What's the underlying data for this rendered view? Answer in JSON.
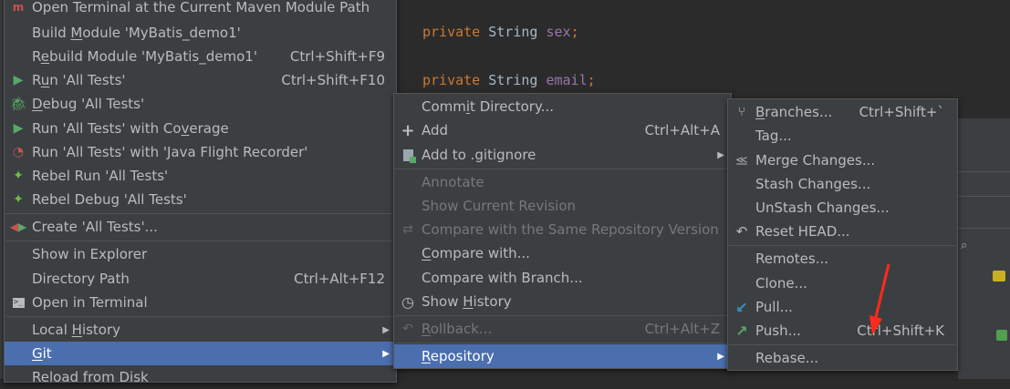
{
  "editor": {
    "line1": {
      "kw": "private",
      "type": "String",
      "field": "sex",
      "punct": ";"
    },
    "line2": {
      "kw": "private",
      "type": "String",
      "field": "email",
      "punct": ";"
    }
  },
  "context_menu": {
    "items": [
      {
        "label": "Open Terminal at the Current Maven Module Path",
        "icon": "maven-icon"
      },
      {
        "label": "Build Module 'MyBatis_demo1'",
        "shortcut": ""
      },
      {
        "label": "Rebuild Module 'MyBatis_demo1'",
        "shortcut": "Ctrl+Shift+F9"
      },
      {
        "label": "Run 'All Tests'",
        "shortcut": "Ctrl+Shift+F10",
        "icon": "run-icon"
      },
      {
        "label": "Debug 'All Tests'",
        "icon": "debug-icon"
      },
      {
        "label": "Run 'All Tests' with Coverage",
        "icon": "coverage-icon"
      },
      {
        "label": "Run 'All Tests' with 'Java Flight Recorder'",
        "icon": "flight-recorder-icon"
      },
      {
        "label": "Rebel Run 'All Tests'",
        "icon": "rebel-run-icon"
      },
      {
        "label": "Rebel Debug 'All Tests'",
        "icon": "rebel-debug-icon"
      },
      {
        "label": "Create 'All Tests'...",
        "icon": "create-test-icon"
      },
      {
        "label": "Show in Explorer"
      },
      {
        "label": "Directory Path",
        "shortcut": "Ctrl+Alt+F12"
      },
      {
        "label": "Open in Terminal",
        "icon": "terminal-icon"
      },
      {
        "label": "Local History"
      },
      {
        "label": "Git"
      },
      {
        "label": "Reload from Disk"
      }
    ]
  },
  "git_menu": {
    "items": [
      {
        "label": "Commit Directory..."
      },
      {
        "label": "Add",
        "shortcut": "Ctrl+Alt+A",
        "icon": "plus-icon"
      },
      {
        "label": "Add to .gitignore",
        "icon": "gitignore-icon"
      },
      {
        "label": "Annotate"
      },
      {
        "label": "Show Current Revision"
      },
      {
        "label": "Compare with the Same Repository Version",
        "icon": "compare-icon"
      },
      {
        "label": "Compare with..."
      },
      {
        "label": "Compare with Branch..."
      },
      {
        "label": "Show History",
        "icon": "history-icon"
      },
      {
        "label": "Rollback...",
        "shortcut": "Ctrl+Alt+Z",
        "icon": "rollback-icon"
      },
      {
        "label": "Repository"
      }
    ]
  },
  "repository_menu": {
    "items": [
      {
        "label": "Branches...",
        "shortcut": "Ctrl+Shift+`",
        "icon": "branch-icon"
      },
      {
        "label": "Tag..."
      },
      {
        "label": "Merge Changes...",
        "icon": "merge-icon"
      },
      {
        "label": "Stash Changes..."
      },
      {
        "label": "UnStash Changes..."
      },
      {
        "label": "Reset HEAD...",
        "icon": "reset-icon"
      },
      {
        "label": "Remotes..."
      },
      {
        "label": "Clone..."
      },
      {
        "label": "Pull...",
        "icon": "pull-icon"
      },
      {
        "label": "Push...",
        "shortcut": "Ctrl+Shift+K",
        "icon": "push-icon"
      },
      {
        "label": "Rebase..."
      }
    ]
  },
  "colors": {
    "selection": "#4b6eaf",
    "menu_bg": "#3c3f41",
    "annotation_arrow": "#ff2a1a"
  }
}
